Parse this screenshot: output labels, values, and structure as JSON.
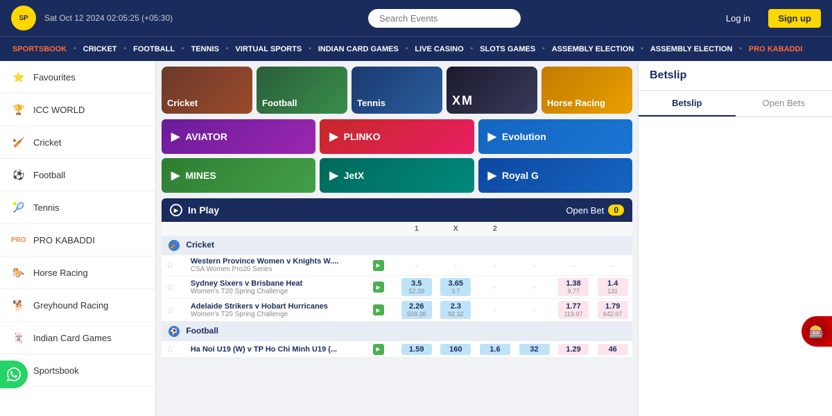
{
  "header": {
    "logo_text": "SP",
    "datetime": "Sat Oct 12 2024 02:05:25  (+05:30)",
    "search_placeholder": "Search Events",
    "login_label": "Log in",
    "signup_label": "Sign up"
  },
  "nav": {
    "items": [
      {
        "label": "SPORTSBOOK",
        "active": true
      },
      {
        "label": "CRICKET"
      },
      {
        "label": "FOOTBALL"
      },
      {
        "label": "TENNIS"
      },
      {
        "label": "VIRTUAL SPORTS"
      },
      {
        "label": "INDIAN CARD GAMES"
      },
      {
        "label": "LIVE CASINO"
      },
      {
        "label": "SLOTS GAMES"
      },
      {
        "label": "ASSEMBLY ELECTION"
      },
      {
        "label": "ASSEMBLY ELECTION"
      },
      {
        "label": "PRO KABADDI",
        "red": true
      }
    ]
  },
  "sidebar": {
    "items": [
      {
        "icon": "⭐",
        "label": "Favourites"
      },
      {
        "icon": "🏆",
        "label": "ICC WORLD"
      },
      {
        "icon": "🏏",
        "label": "Cricket"
      },
      {
        "icon": "⚽",
        "label": "Football"
      },
      {
        "icon": "🎾",
        "label": "Tennis"
      },
      {
        "icon": "🏅",
        "label": "PRO KABADDI"
      },
      {
        "icon": "🐎",
        "label": "Horse Racing"
      },
      {
        "icon": "🐕",
        "label": "Greyhound Racing"
      },
      {
        "icon": "🃏",
        "label": "Indian Card Games"
      },
      {
        "icon": "🏆",
        "label": "Sportsbook"
      }
    ]
  },
  "sport_cards": [
    {
      "label": "Cricket",
      "class": "cricket",
      "icon": "🏏"
    },
    {
      "label": "Football",
      "class": "football",
      "icon": "⚽"
    },
    {
      "label": "Tennis",
      "class": "tennis",
      "icon": "🎾"
    },
    {
      "label": "",
      "class": "xm",
      "icon": ""
    },
    {
      "label": "Horse Racing",
      "class": "horse",
      "icon": "🐎"
    }
  ],
  "game_banners": [
    {
      "label": "AVIATOR",
      "class": "purple"
    },
    {
      "label": "PLINKO",
      "class": "pink"
    },
    {
      "label": "Evolution",
      "class": "blue"
    },
    {
      "label": "MINES",
      "class": "green"
    },
    {
      "label": "JetX",
      "class": "teal"
    },
    {
      "label": "Royal G",
      "class": "dark-blue"
    }
  ],
  "inplay": {
    "title": "In Play",
    "open_bet_label": "Open Bet",
    "open_bet_count": "0"
  },
  "cricket_section": {
    "sport": "Cricket",
    "col1": "1",
    "colx": "X",
    "col2": "2",
    "matches": [
      {
        "title": "Western Province Women v Knights W....",
        "sub": "CSA Women Pro20 Series",
        "odds": [
          "-",
          "-",
          "-",
          "-",
          "-",
          "-"
        ]
      },
      {
        "title": "Sydney Sixers v Brisbane Heat",
        "sub": "Women's T20 Spring Challenge",
        "odds": [
          "3.5",
          "3.65",
          "-",
          "-",
          "1.38",
          "1.4"
        ],
        "odds_sub": [
          "52.39",
          "3.7",
          "",
          "",
          "9.77",
          "131"
        ]
      },
      {
        "title": "Adelaide Strikers v Hobart Hurricanes",
        "sub": "Women's T20 Spring Challenge",
        "odds": [
          "2.26",
          "2.3",
          "-",
          "-",
          "1.77",
          "1.79"
        ],
        "odds_sub": [
          "509.38",
          "92.32",
          "",
          "",
          "119.97",
          "642.07"
        ]
      }
    ]
  },
  "football_section": {
    "sport": "Football",
    "col1": "1",
    "colx": "X",
    "col2": "2",
    "matches": [
      {
        "title": "Ha Noi U19 (W) v TP Ho Chi Minh U19 (...",
        "sub": "",
        "odds": [
          "1.59",
          "160",
          "1.6",
          "32",
          "1.29",
          "46"
        ],
        "odds_sub": [
          "",
          "",
          "",
          "",
          "",
          ""
        ]
      }
    ]
  },
  "betslip": {
    "title": "Betslip",
    "tab_betslip": "Betslip",
    "tab_open_bets": "Open Bets"
  },
  "scrollbar_labels": {
    "prev": "‹",
    "next": "›"
  }
}
